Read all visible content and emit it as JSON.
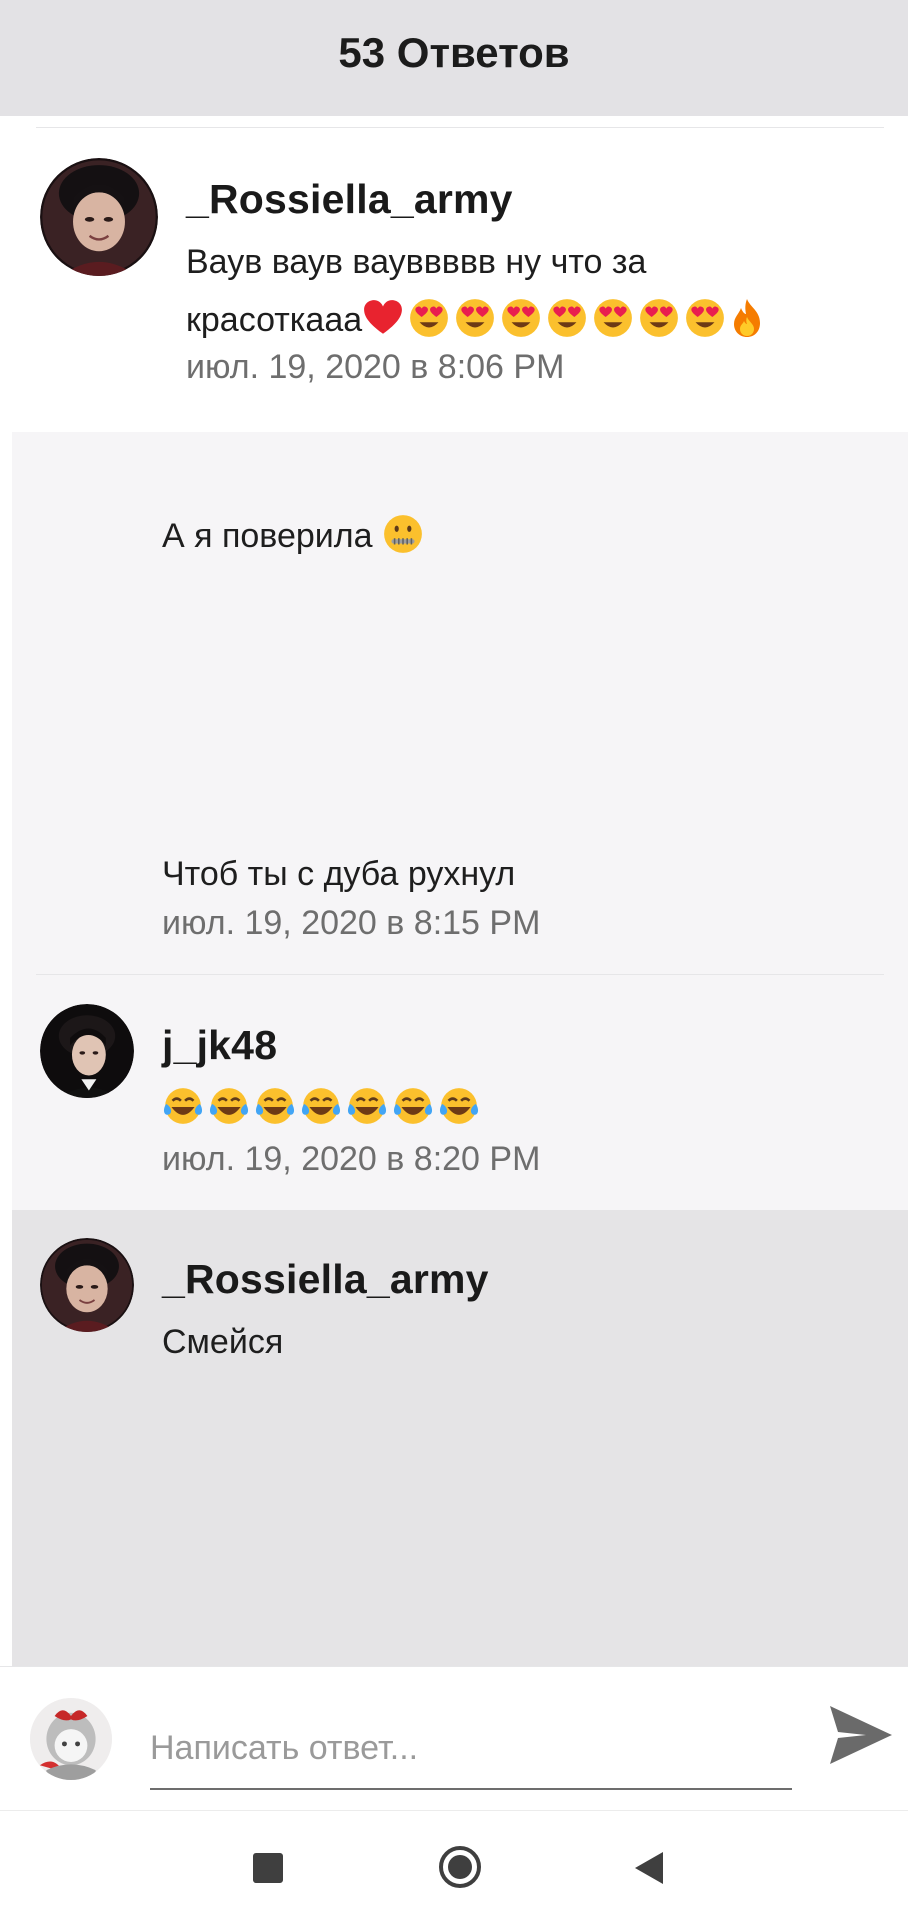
{
  "header": {
    "title": "53 Ответов"
  },
  "comments": [
    {
      "username": "_Rossiella_army",
      "text_line1": "Ваув ваув вауввввв ну что за",
      "text_line2": "красоткааа",
      "timestamp": "июл. 19, 2020 в 8:06 PM"
    },
    {
      "text_line1": "А я поверила",
      "text_line2": "Чтоб ты с  дуба рухнул",
      "timestamp": "июл. 19, 2020 в 8:15 PM"
    },
    {
      "username": "j_jk48",
      "timestamp": "июл. 19, 2020 в 8:20 PM"
    },
    {
      "username": "_Rossiella_army",
      "text": "Смейся"
    }
  ],
  "composer": {
    "placeholder": "Написать ответ..."
  },
  "icons": {
    "heart": "red-heart-icon",
    "heart_eyes": "smiling-face-with-heart-eyes-icon",
    "fire": "fire-icon",
    "zipper": "zipper-mouth-face-icon",
    "joy": "face-with-tears-of-joy-icon",
    "send": "send-icon",
    "nav_recent": "square-icon",
    "nav_home": "circle-icon",
    "nav_back": "triangle-back-icon"
  },
  "colors": {
    "header_bg": "#e3e2e5",
    "highlight_bg": "#e5e4e6",
    "light_bg": "#f6f5f7",
    "timestamp": "#6e6e6e"
  }
}
